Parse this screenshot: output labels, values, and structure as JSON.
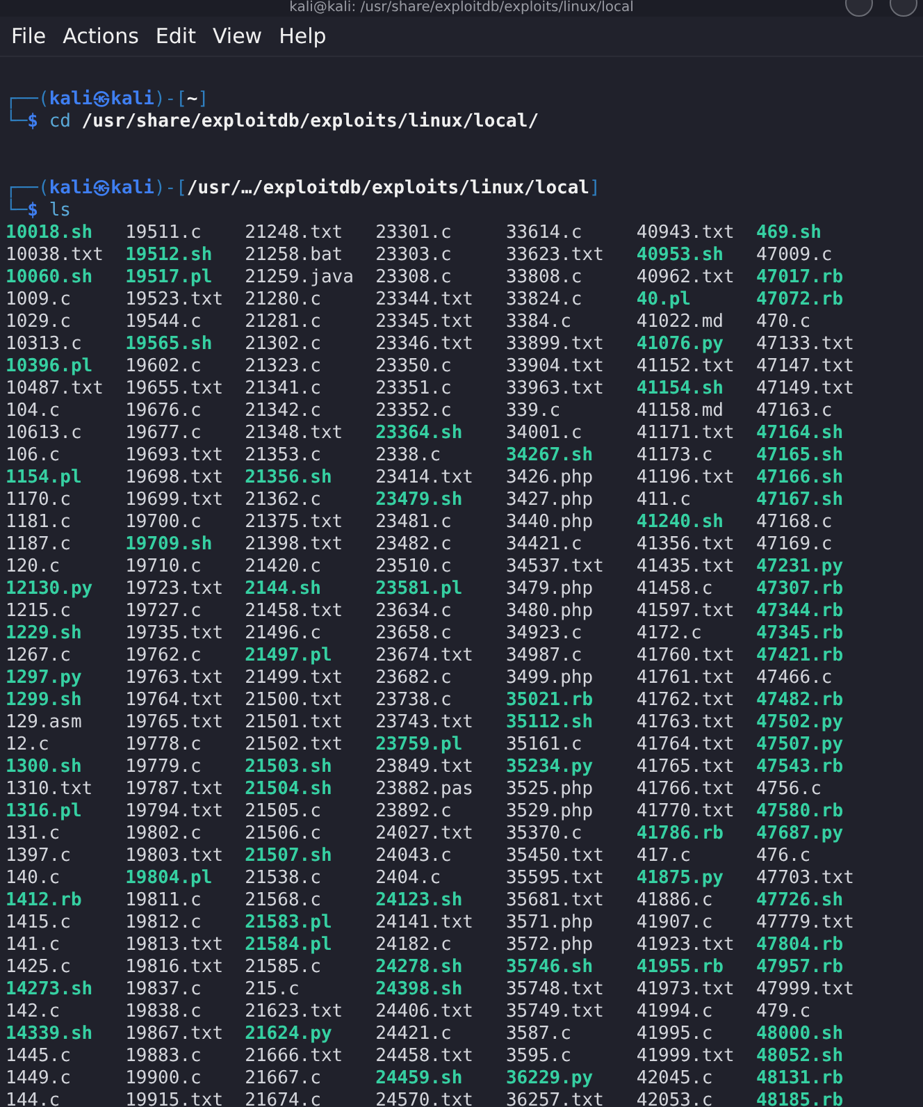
{
  "window": {
    "title": "kali@kali: /usr/share/exploitdb/exploits/linux/local"
  },
  "menu": [
    "File",
    "Actions",
    "Edit",
    "View",
    "Help"
  ],
  "session": [
    {
      "prompt": {
        "corner": "┌──(",
        "user": "kali",
        "separator": "㉿",
        "host": "kali",
        "bracket_open": ")-[",
        "dir": "~",
        "bracket_close": "]"
      },
      "input": {
        "corner": "└─",
        "symbol": "$",
        "command": "cd",
        "argument": "/usr/share/exploitdb/exploits/linux/local/"
      }
    },
    {
      "prompt": {
        "corner": "┌──(",
        "user": "kali",
        "separator": "㉿",
        "host": "kali",
        "bracket_open": ")-[",
        "dir": "/usr/…/exploitdb/exploits/linux/local",
        "bracket_close": "]"
      },
      "input": {
        "corner": "└─",
        "symbol": "$",
        "command": "ls"
      }
    }
  ],
  "listing": {
    "rows": [
      [
        {
          "name": "10018.sh",
          "executable": true
        },
        {
          "name": "19511.c",
          "executable": false
        },
        {
          "name": "21248.txt",
          "executable": false
        },
        {
          "name": "23301.c",
          "executable": false
        },
        {
          "name": "33614.c",
          "executable": false
        },
        {
          "name": "40943.txt",
          "executable": false
        },
        {
          "name": "469.sh",
          "executable": true
        }
      ],
      [
        {
          "name": "10038.txt",
          "executable": false
        },
        {
          "name": "19512.sh",
          "executable": true
        },
        {
          "name": "21258.bat",
          "executable": false
        },
        {
          "name": "23303.c",
          "executable": false
        },
        {
          "name": "33623.txt",
          "executable": false
        },
        {
          "name": "40953.sh",
          "executable": true
        },
        {
          "name": "47009.c",
          "executable": false
        }
      ],
      [
        {
          "name": "10060.sh",
          "executable": true
        },
        {
          "name": "19517.pl",
          "executable": true
        },
        {
          "name": "21259.java",
          "executable": false
        },
        {
          "name": "23308.c",
          "executable": false
        },
        {
          "name": "33808.c",
          "executable": false
        },
        {
          "name": "40962.txt",
          "executable": false
        },
        {
          "name": "47017.rb",
          "executable": true
        }
      ],
      [
        {
          "name": "1009.c",
          "executable": false
        },
        {
          "name": "19523.txt",
          "executable": false
        },
        {
          "name": "21280.c",
          "executable": false
        },
        {
          "name": "23344.txt",
          "executable": false
        },
        {
          "name": "33824.c",
          "executable": false
        },
        {
          "name": "40.pl",
          "executable": true
        },
        {
          "name": "47072.rb",
          "executable": true
        }
      ],
      [
        {
          "name": "1029.c",
          "executable": false
        },
        {
          "name": "19544.c",
          "executable": false
        },
        {
          "name": "21281.c",
          "executable": false
        },
        {
          "name": "23345.txt",
          "executable": false
        },
        {
          "name": "3384.c",
          "executable": false
        },
        {
          "name": "41022.md",
          "executable": false
        },
        {
          "name": "470.c",
          "executable": false
        }
      ],
      [
        {
          "name": "10313.c",
          "executable": false
        },
        {
          "name": "19565.sh",
          "executable": true
        },
        {
          "name": "21302.c",
          "executable": false
        },
        {
          "name": "23346.txt",
          "executable": false
        },
        {
          "name": "33899.txt",
          "executable": false
        },
        {
          "name": "41076.py",
          "executable": true
        },
        {
          "name": "47133.txt",
          "executable": false
        }
      ],
      [
        {
          "name": "10396.pl",
          "executable": true
        },
        {
          "name": "19602.c",
          "executable": false
        },
        {
          "name": "21323.c",
          "executable": false
        },
        {
          "name": "23350.c",
          "executable": false
        },
        {
          "name": "33904.txt",
          "executable": false
        },
        {
          "name": "41152.txt",
          "executable": false
        },
        {
          "name": "47147.txt",
          "executable": false
        }
      ],
      [
        {
          "name": "10487.txt",
          "executable": false
        },
        {
          "name": "19655.txt",
          "executable": false
        },
        {
          "name": "21341.c",
          "executable": false
        },
        {
          "name": "23351.c",
          "executable": false
        },
        {
          "name": "33963.txt",
          "executable": false
        },
        {
          "name": "41154.sh",
          "executable": true
        },
        {
          "name": "47149.txt",
          "executable": false
        }
      ],
      [
        {
          "name": "104.c",
          "executable": false
        },
        {
          "name": "19676.c",
          "executable": false
        },
        {
          "name": "21342.c",
          "executable": false
        },
        {
          "name": "23352.c",
          "executable": false
        },
        {
          "name": "339.c",
          "executable": false
        },
        {
          "name": "41158.md",
          "executable": false
        },
        {
          "name": "47163.c",
          "executable": false
        }
      ],
      [
        {
          "name": "10613.c",
          "executable": false
        },
        {
          "name": "19677.c",
          "executable": false
        },
        {
          "name": "21348.txt",
          "executable": false
        },
        {
          "name": "23364.sh",
          "executable": true
        },
        {
          "name": "34001.c",
          "executable": false
        },
        {
          "name": "41171.txt",
          "executable": false
        },
        {
          "name": "47164.sh",
          "executable": true
        }
      ],
      [
        {
          "name": "106.c",
          "executable": false
        },
        {
          "name": "19693.txt",
          "executable": false
        },
        {
          "name": "21353.c",
          "executable": false
        },
        {
          "name": "2338.c",
          "executable": false
        },
        {
          "name": "34267.sh",
          "executable": true
        },
        {
          "name": "41173.c",
          "executable": false
        },
        {
          "name": "47165.sh",
          "executable": true
        }
      ],
      [
        {
          "name": "1154.pl",
          "executable": true
        },
        {
          "name": "19698.txt",
          "executable": false
        },
        {
          "name": "21356.sh",
          "executable": true
        },
        {
          "name": "23414.txt",
          "executable": false
        },
        {
          "name": "3426.php",
          "executable": false
        },
        {
          "name": "41196.txt",
          "executable": false
        },
        {
          "name": "47166.sh",
          "executable": true
        }
      ],
      [
        {
          "name": "1170.c",
          "executable": false
        },
        {
          "name": "19699.txt",
          "executable": false
        },
        {
          "name": "21362.c",
          "executable": false
        },
        {
          "name": "23479.sh",
          "executable": true
        },
        {
          "name": "3427.php",
          "executable": false
        },
        {
          "name": "411.c",
          "executable": false
        },
        {
          "name": "47167.sh",
          "executable": true
        }
      ],
      [
        {
          "name": "1181.c",
          "executable": false
        },
        {
          "name": "19700.c",
          "executable": false
        },
        {
          "name": "21375.txt",
          "executable": false
        },
        {
          "name": "23481.c",
          "executable": false
        },
        {
          "name": "3440.php",
          "executable": false
        },
        {
          "name": "41240.sh",
          "executable": true
        },
        {
          "name": "47168.c",
          "executable": false
        }
      ],
      [
        {
          "name": "1187.c",
          "executable": false
        },
        {
          "name": "19709.sh",
          "executable": true
        },
        {
          "name": "21398.txt",
          "executable": false
        },
        {
          "name": "23482.c",
          "executable": false
        },
        {
          "name": "34421.c",
          "executable": false
        },
        {
          "name": "41356.txt",
          "executable": false
        },
        {
          "name": "47169.c",
          "executable": false
        }
      ],
      [
        {
          "name": "120.c",
          "executable": false
        },
        {
          "name": "19710.c",
          "executable": false
        },
        {
          "name": "21420.c",
          "executable": false
        },
        {
          "name": "23510.c",
          "executable": false
        },
        {
          "name": "34537.txt",
          "executable": false
        },
        {
          "name": "41435.txt",
          "executable": false
        },
        {
          "name": "47231.py",
          "executable": true
        }
      ],
      [
        {
          "name": "12130.py",
          "executable": true
        },
        {
          "name": "19723.txt",
          "executable": false
        },
        {
          "name": "2144.sh",
          "executable": true
        },
        {
          "name": "23581.pl",
          "executable": true
        },
        {
          "name": "3479.php",
          "executable": false
        },
        {
          "name": "41458.c",
          "executable": false
        },
        {
          "name": "47307.rb",
          "executable": true
        }
      ],
      [
        {
          "name": "1215.c",
          "executable": false
        },
        {
          "name": "19727.c",
          "executable": false
        },
        {
          "name": "21458.txt",
          "executable": false
        },
        {
          "name": "23634.c",
          "executable": false
        },
        {
          "name": "3480.php",
          "executable": false
        },
        {
          "name": "41597.txt",
          "executable": false
        },
        {
          "name": "47344.rb",
          "executable": true
        }
      ],
      [
        {
          "name": "1229.sh",
          "executable": true
        },
        {
          "name": "19735.txt",
          "executable": false
        },
        {
          "name": "21496.c",
          "executable": false
        },
        {
          "name": "23658.c",
          "executable": false
        },
        {
          "name": "34923.c",
          "executable": false
        },
        {
          "name": "4172.c",
          "executable": false
        },
        {
          "name": "47345.rb",
          "executable": true
        }
      ],
      [
        {
          "name": "1267.c",
          "executable": false
        },
        {
          "name": "19762.c",
          "executable": false
        },
        {
          "name": "21497.pl",
          "executable": true
        },
        {
          "name": "23674.txt",
          "executable": false
        },
        {
          "name": "34987.c",
          "executable": false
        },
        {
          "name": "41760.txt",
          "executable": false
        },
        {
          "name": "47421.rb",
          "executable": true
        }
      ],
      [
        {
          "name": "1297.py",
          "executable": true
        },
        {
          "name": "19763.txt",
          "executable": false
        },
        {
          "name": "21499.txt",
          "executable": false
        },
        {
          "name": "23682.c",
          "executable": false
        },
        {
          "name": "3499.php",
          "executable": false
        },
        {
          "name": "41761.txt",
          "executable": false
        },
        {
          "name": "47466.c",
          "executable": false
        }
      ],
      [
        {
          "name": "1299.sh",
          "executable": true
        },
        {
          "name": "19764.txt",
          "executable": false
        },
        {
          "name": "21500.txt",
          "executable": false
        },
        {
          "name": "23738.c",
          "executable": false
        },
        {
          "name": "35021.rb",
          "executable": true
        },
        {
          "name": "41762.txt",
          "executable": false
        },
        {
          "name": "47482.rb",
          "executable": true
        }
      ],
      [
        {
          "name": "129.asm",
          "executable": false
        },
        {
          "name": "19765.txt",
          "executable": false
        },
        {
          "name": "21501.txt",
          "executable": false
        },
        {
          "name": "23743.txt",
          "executable": false
        },
        {
          "name": "35112.sh",
          "executable": true
        },
        {
          "name": "41763.txt",
          "executable": false
        },
        {
          "name": "47502.py",
          "executable": true
        }
      ],
      [
        {
          "name": "12.c",
          "executable": false
        },
        {
          "name": "19778.c",
          "executable": false
        },
        {
          "name": "21502.txt",
          "executable": false
        },
        {
          "name": "23759.pl",
          "executable": true
        },
        {
          "name": "35161.c",
          "executable": false
        },
        {
          "name": "41764.txt",
          "executable": false
        },
        {
          "name": "47507.py",
          "executable": true
        }
      ],
      [
        {
          "name": "1300.sh",
          "executable": true
        },
        {
          "name": "19779.c",
          "executable": false
        },
        {
          "name": "21503.sh",
          "executable": true
        },
        {
          "name": "23849.txt",
          "executable": false
        },
        {
          "name": "35234.py",
          "executable": true
        },
        {
          "name": "41765.txt",
          "executable": false
        },
        {
          "name": "47543.rb",
          "executable": true
        }
      ],
      [
        {
          "name": "1310.txt",
          "executable": false
        },
        {
          "name": "19787.txt",
          "executable": false
        },
        {
          "name": "21504.sh",
          "executable": true
        },
        {
          "name": "23882.pas",
          "executable": false
        },
        {
          "name": "3525.php",
          "executable": false
        },
        {
          "name": "41766.txt",
          "executable": false
        },
        {
          "name": "4756.c",
          "executable": false
        }
      ],
      [
        {
          "name": "1316.pl",
          "executable": true
        },
        {
          "name": "19794.txt",
          "executable": false
        },
        {
          "name": "21505.c",
          "executable": false
        },
        {
          "name": "23892.c",
          "executable": false
        },
        {
          "name": "3529.php",
          "executable": false
        },
        {
          "name": "41770.txt",
          "executable": false
        },
        {
          "name": "47580.rb",
          "executable": true
        }
      ],
      [
        {
          "name": "131.c",
          "executable": false
        },
        {
          "name": "19802.c",
          "executable": false
        },
        {
          "name": "21506.c",
          "executable": false
        },
        {
          "name": "24027.txt",
          "executable": false
        },
        {
          "name": "35370.c",
          "executable": false
        },
        {
          "name": "41786.rb",
          "executable": true
        },
        {
          "name": "47687.py",
          "executable": true
        }
      ],
      [
        {
          "name": "1397.c",
          "executable": false
        },
        {
          "name": "19803.txt",
          "executable": false
        },
        {
          "name": "21507.sh",
          "executable": true
        },
        {
          "name": "24043.c",
          "executable": false
        },
        {
          "name": "35450.txt",
          "executable": false
        },
        {
          "name": "417.c",
          "executable": false
        },
        {
          "name": "476.c",
          "executable": false
        }
      ],
      [
        {
          "name": "140.c",
          "executable": false
        },
        {
          "name": "19804.pl",
          "executable": true
        },
        {
          "name": "21538.c",
          "executable": false
        },
        {
          "name": "2404.c",
          "executable": false
        },
        {
          "name": "35595.txt",
          "executable": false
        },
        {
          "name": "41875.py",
          "executable": true
        },
        {
          "name": "47703.txt",
          "executable": false
        }
      ],
      [
        {
          "name": "1412.rb",
          "executable": true
        },
        {
          "name": "19811.c",
          "executable": false
        },
        {
          "name": "21568.c",
          "executable": false
        },
        {
          "name": "24123.sh",
          "executable": true
        },
        {
          "name": "35681.txt",
          "executable": false
        },
        {
          "name": "41886.c",
          "executable": false
        },
        {
          "name": "47726.sh",
          "executable": true
        }
      ],
      [
        {
          "name": "1415.c",
          "executable": false
        },
        {
          "name": "19812.c",
          "executable": false
        },
        {
          "name": "21583.pl",
          "executable": true
        },
        {
          "name": "24141.txt",
          "executable": false
        },
        {
          "name": "3571.php",
          "executable": false
        },
        {
          "name": "41907.c",
          "executable": false
        },
        {
          "name": "47779.txt",
          "executable": false
        }
      ],
      [
        {
          "name": "141.c",
          "executable": false
        },
        {
          "name": "19813.txt",
          "executable": false
        },
        {
          "name": "21584.pl",
          "executable": true
        },
        {
          "name": "24182.c",
          "executable": false
        },
        {
          "name": "3572.php",
          "executable": false
        },
        {
          "name": "41923.txt",
          "executable": false
        },
        {
          "name": "47804.rb",
          "executable": true
        }
      ],
      [
        {
          "name": "1425.c",
          "executable": false
        },
        {
          "name": "19816.txt",
          "executable": false
        },
        {
          "name": "21585.c",
          "executable": false
        },
        {
          "name": "24278.sh",
          "executable": true
        },
        {
          "name": "35746.sh",
          "executable": true
        },
        {
          "name": "41955.rb",
          "executable": true
        },
        {
          "name": "47957.rb",
          "executable": true
        }
      ],
      [
        {
          "name": "14273.sh",
          "executable": true
        },
        {
          "name": "19837.c",
          "executable": false
        },
        {
          "name": "215.c",
          "executable": false
        },
        {
          "name": "24398.sh",
          "executable": true
        },
        {
          "name": "35748.txt",
          "executable": false
        },
        {
          "name": "41973.txt",
          "executable": false
        },
        {
          "name": "47999.txt",
          "executable": false
        }
      ],
      [
        {
          "name": "142.c",
          "executable": false
        },
        {
          "name": "19838.c",
          "executable": false
        },
        {
          "name": "21623.txt",
          "executable": false
        },
        {
          "name": "24406.txt",
          "executable": false
        },
        {
          "name": "35749.txt",
          "executable": false
        },
        {
          "name": "41994.c",
          "executable": false
        },
        {
          "name": "479.c",
          "executable": false
        }
      ],
      [
        {
          "name": "14339.sh",
          "executable": true
        },
        {
          "name": "19867.txt",
          "executable": false
        },
        {
          "name": "21624.py",
          "executable": true
        },
        {
          "name": "24421.c",
          "executable": false
        },
        {
          "name": "3587.c",
          "executable": false
        },
        {
          "name": "41995.c",
          "executable": false
        },
        {
          "name": "48000.sh",
          "executable": true
        }
      ],
      [
        {
          "name": "1445.c",
          "executable": false
        },
        {
          "name": "19883.c",
          "executable": false
        },
        {
          "name": "21666.txt",
          "executable": false
        },
        {
          "name": "24458.txt",
          "executable": false
        },
        {
          "name": "3595.c",
          "executable": false
        },
        {
          "name": "41999.txt",
          "executable": false
        },
        {
          "name": "48052.sh",
          "executable": true
        }
      ],
      [
        {
          "name": "1449.c",
          "executable": false
        },
        {
          "name": "19900.c",
          "executable": false
        },
        {
          "name": "21667.c",
          "executable": false
        },
        {
          "name": "24459.sh",
          "executable": true
        },
        {
          "name": "36229.py",
          "executable": true
        },
        {
          "name": "42045.c",
          "executable": false
        },
        {
          "name": "48131.rb",
          "executable": true
        }
      ],
      [
        {
          "name": "144.c",
          "executable": false
        },
        {
          "name": "19915.txt",
          "executable": false
        },
        {
          "name": "21674.c",
          "executable": false
        },
        {
          "name": "24570.txt",
          "executable": false
        },
        {
          "name": "36257.txt",
          "executable": false
        },
        {
          "name": "42053.c",
          "executable": false
        },
        {
          "name": "48185.rb",
          "executable": true
        }
      ]
    ]
  }
}
